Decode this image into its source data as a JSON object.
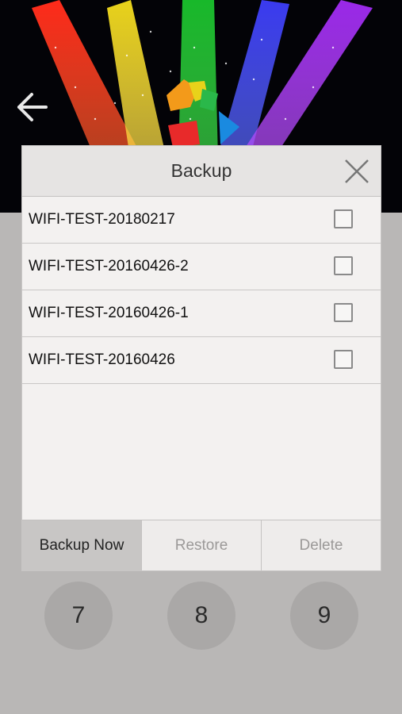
{
  "dialog": {
    "title": "Backup",
    "items": [
      {
        "label": "WIFI-TEST-20180217",
        "checked": false
      },
      {
        "label": "WIFI-TEST-20160426-2",
        "checked": false
      },
      {
        "label": "WIFI-TEST-20160426-1",
        "checked": false
      },
      {
        "label": "WIFI-TEST-20160426",
        "checked": false
      }
    ],
    "buttons": {
      "backup_now": "Backup Now",
      "restore": "Restore",
      "delete": "Delete"
    }
  },
  "keypad": [
    "7",
    "8",
    "9"
  ],
  "icons": {
    "back": "back-arrow-icon",
    "close": "close-icon",
    "logo": "app-logo"
  },
  "colors": {
    "background": "#b9b7b6",
    "dialog": "#f3f1f0",
    "header": "#020205"
  }
}
